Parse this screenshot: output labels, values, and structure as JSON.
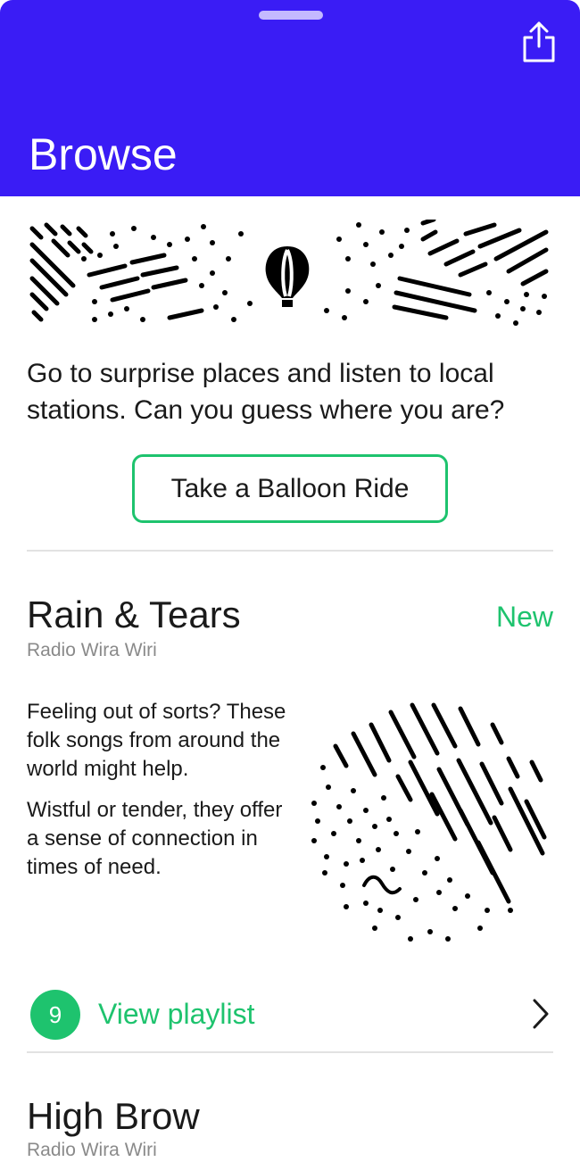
{
  "header": {
    "title": "Browse",
    "share_icon": "share-icon",
    "background_color": "#3a1cf5"
  },
  "hero": {
    "icon": "hot-air-balloon-icon",
    "text": "Go to surprise places and listen to local stations. Can you guess where you are?",
    "button_label": "Take a Balloon Ride",
    "accent_color": "#1ec36e"
  },
  "cards": [
    {
      "title": "Rain & Tears",
      "subtitle": "Radio Wira Wiri",
      "badge": "New",
      "description": [
        "Feeling out of sorts? These folk songs from around the world might help.",
        "Wistful or tender, they offer a sense of connection in times of need."
      ],
      "playlist_count": "9",
      "playlist_label": "View playlist",
      "chevron_icon": "chevron-right-icon"
    },
    {
      "title": "High Brow",
      "subtitle": "Radio Wira Wiri"
    }
  ]
}
